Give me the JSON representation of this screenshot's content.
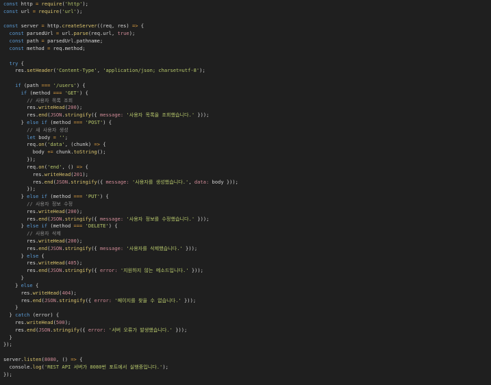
{
  "editor": {
    "colors": {
      "keyword": "#5b9bd5",
      "function": "#dcc56e",
      "string": "#b8c96c",
      "number": "#cf8a96",
      "operator": "#e0a040",
      "comment": "#8c8c8c",
      "text": "#d6d6d6",
      "background": "#1f1f1f"
    },
    "lines": [
      [
        [
          "k",
          "const"
        ],
        [
          "p",
          " http "
        ],
        [
          "o",
          "="
        ],
        [
          "p",
          " "
        ],
        [
          "f",
          "require"
        ],
        [
          "p",
          "("
        ],
        [
          "s",
          "'http'"
        ],
        [
          "p",
          ");"
        ]
      ],
      [
        [
          "k",
          "const"
        ],
        [
          "p",
          " url "
        ],
        [
          "o",
          "="
        ],
        [
          "p",
          " "
        ],
        [
          "f",
          "require"
        ],
        [
          "p",
          "("
        ],
        [
          "s",
          "'url'"
        ],
        [
          "p",
          ");"
        ]
      ],
      [],
      [
        [
          "k",
          "const"
        ],
        [
          "p",
          " server "
        ],
        [
          "o",
          "="
        ],
        [
          "p",
          " http."
        ],
        [
          "f",
          "createServer"
        ],
        [
          "p",
          "((req, res) "
        ],
        [
          "o",
          "=>"
        ],
        [
          "p",
          " {"
        ]
      ],
      [
        [
          "p",
          "  "
        ],
        [
          "k",
          "const"
        ],
        [
          "p",
          " parsedUrl "
        ],
        [
          "o",
          "="
        ],
        [
          "p",
          " url."
        ],
        [
          "f",
          "parse"
        ],
        [
          "p",
          "(req.url, "
        ],
        [
          "n",
          "true"
        ],
        [
          "p",
          ");"
        ]
      ],
      [
        [
          "p",
          "  "
        ],
        [
          "k",
          "const"
        ],
        [
          "p",
          " path "
        ],
        [
          "o",
          "="
        ],
        [
          "p",
          " parsedUrl.pathname;"
        ]
      ],
      [
        [
          "p",
          "  "
        ],
        [
          "k",
          "const"
        ],
        [
          "p",
          " method "
        ],
        [
          "o",
          "="
        ],
        [
          "p",
          " req.method;"
        ]
      ],
      [],
      [
        [
          "p",
          "  "
        ],
        [
          "k",
          "try"
        ],
        [
          "p",
          " {"
        ]
      ],
      [
        [
          "p",
          "    res."
        ],
        [
          "f",
          "setHeader"
        ],
        [
          "p",
          "("
        ],
        [
          "s",
          "'Content-Type'"
        ],
        [
          "p",
          ", "
        ],
        [
          "s",
          "'application/json; charset=utf-8'"
        ],
        [
          "p",
          ");"
        ]
      ],
      [],
      [
        [
          "p",
          "    "
        ],
        [
          "k",
          "if"
        ],
        [
          "p",
          " (path "
        ],
        [
          "o",
          "==="
        ],
        [
          "p",
          " "
        ],
        [
          "s",
          "'/users'"
        ],
        [
          "p",
          ") {"
        ]
      ],
      [
        [
          "p",
          "      "
        ],
        [
          "k",
          "if"
        ],
        [
          "p",
          " (method "
        ],
        [
          "o",
          "==="
        ],
        [
          "p",
          " "
        ],
        [
          "s",
          "'GET'"
        ],
        [
          "p",
          ") {"
        ]
      ],
      [
        [
          "p",
          "        "
        ],
        [
          "c",
          "// 사용자 목록 조회"
        ]
      ],
      [
        [
          "p",
          "        res."
        ],
        [
          "f",
          "writeHead"
        ],
        [
          "p",
          "("
        ],
        [
          "n",
          "200"
        ],
        [
          "p",
          ");"
        ]
      ],
      [
        [
          "p",
          "        res."
        ],
        [
          "f",
          "end"
        ],
        [
          "p",
          "("
        ],
        [
          "n",
          "JSON"
        ],
        [
          "p",
          "."
        ],
        [
          "f",
          "stringify"
        ],
        [
          "p",
          "({ "
        ],
        [
          "n",
          "message:"
        ],
        [
          "p",
          " "
        ],
        [
          "s",
          "'사용자 목록을 조회했습니다.'"
        ],
        [
          "p",
          " }));"
        ]
      ],
      [
        [
          "p",
          "      } "
        ],
        [
          "k",
          "else if"
        ],
        [
          "p",
          " (method "
        ],
        [
          "o",
          "==="
        ],
        [
          "p",
          " "
        ],
        [
          "s",
          "'POST'"
        ],
        [
          "p",
          ") {"
        ]
      ],
      [
        [
          "p",
          "        "
        ],
        [
          "c",
          "// 새 사용자 생성"
        ]
      ],
      [
        [
          "p",
          "        "
        ],
        [
          "k",
          "let"
        ],
        [
          "p",
          " body "
        ],
        [
          "o",
          "="
        ],
        [
          "p",
          " "
        ],
        [
          "s",
          "''"
        ],
        [
          "p",
          ";"
        ]
      ],
      [
        [
          "p",
          "        req."
        ],
        [
          "f",
          "on"
        ],
        [
          "p",
          "("
        ],
        [
          "s",
          "'data'"
        ],
        [
          "p",
          ", (chunk) "
        ],
        [
          "o",
          "=>"
        ],
        [
          "p",
          " {"
        ]
      ],
      [
        [
          "p",
          "          body "
        ],
        [
          "o",
          "+="
        ],
        [
          "p",
          " chunk."
        ],
        [
          "f",
          "toString"
        ],
        [
          "p",
          "();"
        ]
      ],
      [
        [
          "p",
          "        });"
        ]
      ],
      [
        [
          "p",
          "        req."
        ],
        [
          "f",
          "on"
        ],
        [
          "p",
          "("
        ],
        [
          "s",
          "'end'"
        ],
        [
          "p",
          ", () "
        ],
        [
          "o",
          "=>"
        ],
        [
          "p",
          " {"
        ]
      ],
      [
        [
          "p",
          "          res."
        ],
        [
          "f",
          "writeHead"
        ],
        [
          "p",
          "("
        ],
        [
          "n",
          "201"
        ],
        [
          "p",
          ");"
        ]
      ],
      [
        [
          "p",
          "          res."
        ],
        [
          "f",
          "end"
        ],
        [
          "p",
          "("
        ],
        [
          "n",
          "JSON"
        ],
        [
          "p",
          "."
        ],
        [
          "f",
          "stringify"
        ],
        [
          "p",
          "({ "
        ],
        [
          "n",
          "message:"
        ],
        [
          "p",
          " "
        ],
        [
          "s",
          "'사용자를 생성했습니다.'"
        ],
        [
          "p",
          ", "
        ],
        [
          "n",
          "data:"
        ],
        [
          "p",
          " body }));"
        ]
      ],
      [
        [
          "p",
          "        });"
        ]
      ],
      [
        [
          "p",
          "      } "
        ],
        [
          "k",
          "else if"
        ],
        [
          "p",
          " (method "
        ],
        [
          "o",
          "==="
        ],
        [
          "p",
          " "
        ],
        [
          "s",
          "'PUT'"
        ],
        [
          "p",
          ") {"
        ]
      ],
      [
        [
          "p",
          "        "
        ],
        [
          "c",
          "// 사용자 정보 수정"
        ]
      ],
      [
        [
          "p",
          "        res."
        ],
        [
          "f",
          "writeHead"
        ],
        [
          "p",
          "("
        ],
        [
          "n",
          "200"
        ],
        [
          "p",
          ");"
        ]
      ],
      [
        [
          "p",
          "        res."
        ],
        [
          "f",
          "end"
        ],
        [
          "p",
          "("
        ],
        [
          "n",
          "JSON"
        ],
        [
          "p",
          "."
        ],
        [
          "f",
          "stringify"
        ],
        [
          "p",
          "({ "
        ],
        [
          "n",
          "message:"
        ],
        [
          "p",
          " "
        ],
        [
          "s",
          "'사용자 정보를 수정했습니다.'"
        ],
        [
          "p",
          " }));"
        ]
      ],
      [
        [
          "p",
          "      } "
        ],
        [
          "k",
          "else if"
        ],
        [
          "p",
          " (method "
        ],
        [
          "o",
          "==="
        ],
        [
          "p",
          " "
        ],
        [
          "s",
          "'DELETE'"
        ],
        [
          "p",
          ") {"
        ]
      ],
      [
        [
          "p",
          "        "
        ],
        [
          "c",
          "// 사용자 삭제"
        ]
      ],
      [
        [
          "p",
          "        res."
        ],
        [
          "f",
          "writeHead"
        ],
        [
          "p",
          "("
        ],
        [
          "n",
          "200"
        ],
        [
          "p",
          ");"
        ]
      ],
      [
        [
          "p",
          "        res."
        ],
        [
          "f",
          "end"
        ],
        [
          "p",
          "("
        ],
        [
          "n",
          "JSON"
        ],
        [
          "p",
          "."
        ],
        [
          "f",
          "stringify"
        ],
        [
          "p",
          "({ "
        ],
        [
          "n",
          "message:"
        ],
        [
          "p",
          " "
        ],
        [
          "s",
          "'사용자를 삭제했습니다.'"
        ],
        [
          "p",
          " }));"
        ]
      ],
      [
        [
          "p",
          "      } "
        ],
        [
          "k",
          "else"
        ],
        [
          "p",
          " {"
        ]
      ],
      [
        [
          "p",
          "        res."
        ],
        [
          "f",
          "writeHead"
        ],
        [
          "p",
          "("
        ],
        [
          "n",
          "405"
        ],
        [
          "p",
          ");"
        ]
      ],
      [
        [
          "p",
          "        res."
        ],
        [
          "f",
          "end"
        ],
        [
          "p",
          "("
        ],
        [
          "n",
          "JSON"
        ],
        [
          "p",
          "."
        ],
        [
          "f",
          "stringify"
        ],
        [
          "p",
          "({ "
        ],
        [
          "n",
          "error:"
        ],
        [
          "p",
          " "
        ],
        [
          "s",
          "'지원하지 않는 메소드입니다.'"
        ],
        [
          "p",
          " }));"
        ]
      ],
      [
        [
          "p",
          "      }"
        ]
      ],
      [
        [
          "p",
          "    } "
        ],
        [
          "k",
          "else"
        ],
        [
          "p",
          " {"
        ]
      ],
      [
        [
          "p",
          "      res."
        ],
        [
          "f",
          "writeHead"
        ],
        [
          "p",
          "("
        ],
        [
          "n",
          "404"
        ],
        [
          "p",
          ");"
        ]
      ],
      [
        [
          "p",
          "      res."
        ],
        [
          "f",
          "end"
        ],
        [
          "p",
          "("
        ],
        [
          "n",
          "JSON"
        ],
        [
          "p",
          "."
        ],
        [
          "f",
          "stringify"
        ],
        [
          "p",
          "({ "
        ],
        [
          "n",
          "error:"
        ],
        [
          "p",
          " "
        ],
        [
          "s",
          "'페이지를 찾을 수 없습니다.'"
        ],
        [
          "p",
          " }));"
        ]
      ],
      [
        [
          "p",
          "    }"
        ]
      ],
      [
        [
          "p",
          "  } "
        ],
        [
          "k",
          "catch"
        ],
        [
          "p",
          " (error) {"
        ]
      ],
      [
        [
          "p",
          "    res."
        ],
        [
          "f",
          "writeHead"
        ],
        [
          "p",
          "("
        ],
        [
          "n",
          "500"
        ],
        [
          "p",
          ");"
        ]
      ],
      [
        [
          "p",
          "    res."
        ],
        [
          "f",
          "end"
        ],
        [
          "p",
          "("
        ],
        [
          "n",
          "JSON"
        ],
        [
          "p",
          "."
        ],
        [
          "f",
          "stringify"
        ],
        [
          "p",
          "({ "
        ],
        [
          "n",
          "error:"
        ],
        [
          "p",
          " "
        ],
        [
          "s",
          "'서버 오류가 발생했습니다.'"
        ],
        [
          "p",
          " }));"
        ]
      ],
      [
        [
          "p",
          "  }"
        ]
      ],
      [
        [
          "p",
          "});"
        ]
      ],
      [],
      [
        [
          "p",
          "server."
        ],
        [
          "f",
          "listen"
        ],
        [
          "p",
          "("
        ],
        [
          "n",
          "8080"
        ],
        [
          "p",
          ", () "
        ],
        [
          "o",
          "=>"
        ],
        [
          "p",
          " {"
        ]
      ],
      [
        [
          "p",
          "  console."
        ],
        [
          "f",
          "log"
        ],
        [
          "p",
          "("
        ],
        [
          "s",
          "'REST API 서버가 8080번 포트에서 실행중입니다.'"
        ],
        [
          "p",
          ");"
        ]
      ],
      [
        [
          "p",
          "});"
        ]
      ]
    ]
  }
}
